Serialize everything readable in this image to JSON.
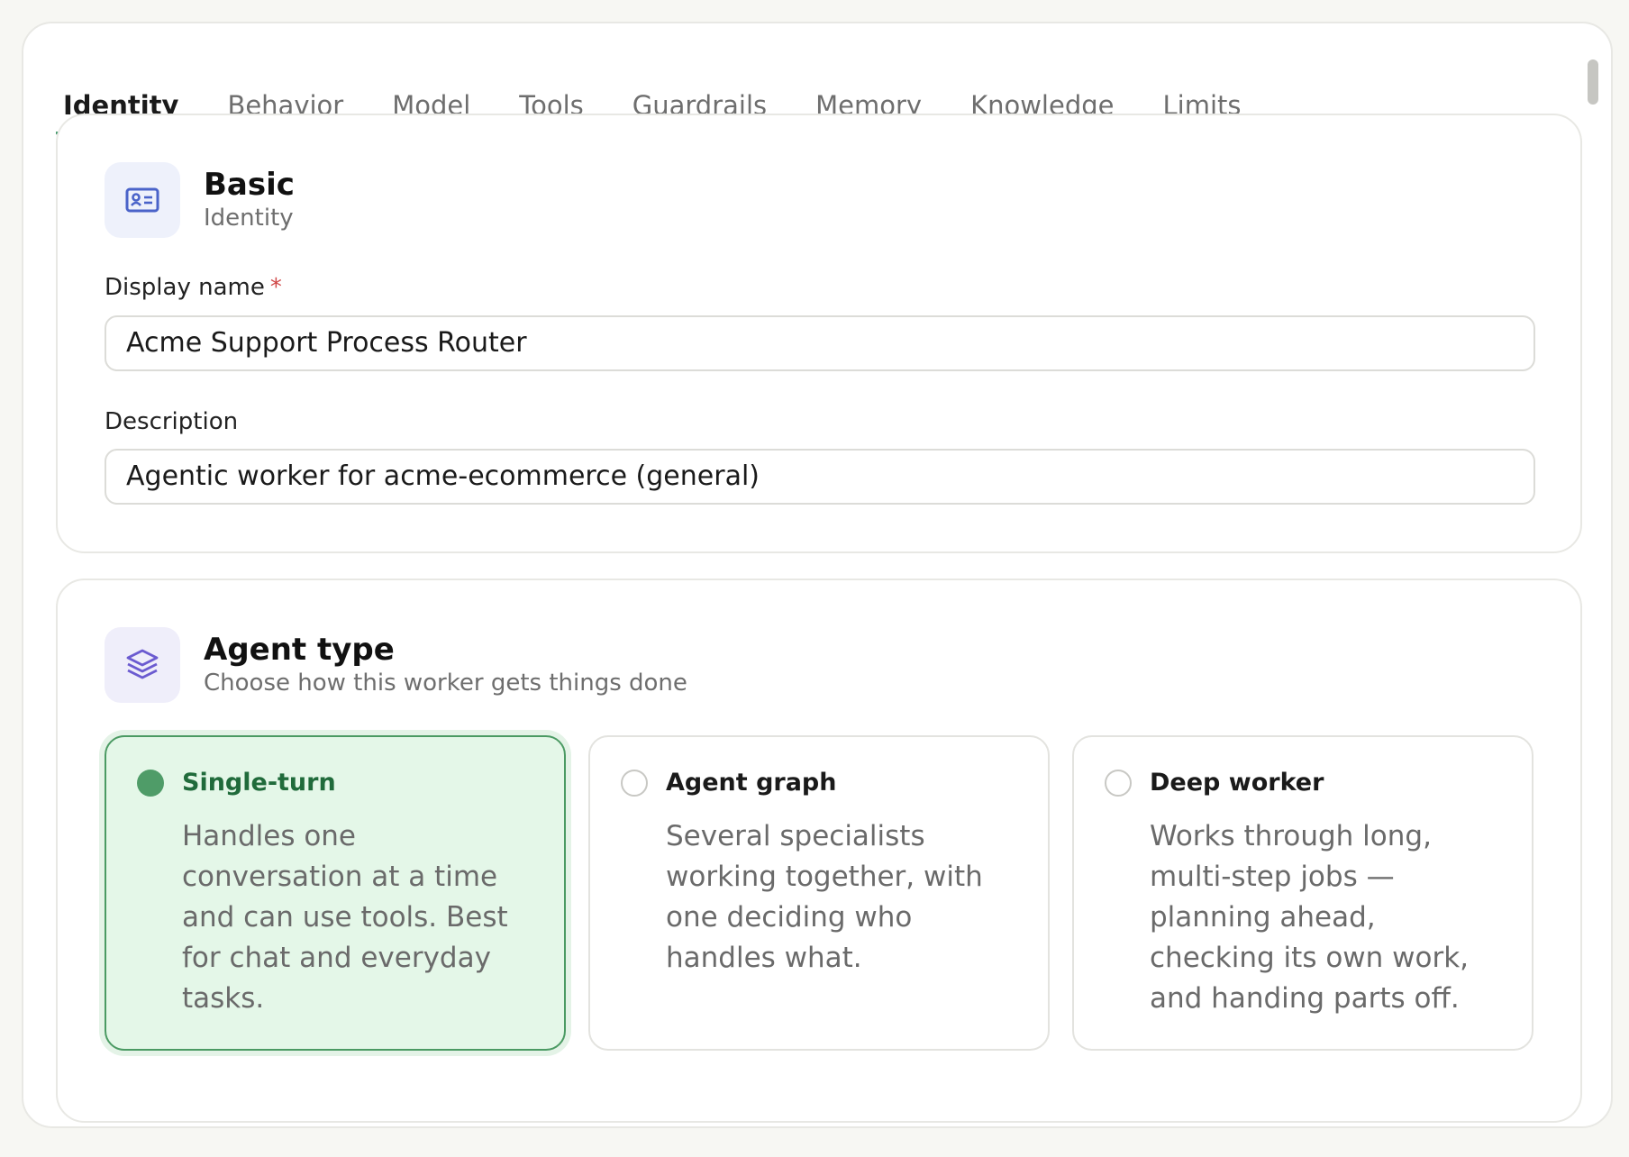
{
  "tabs": [
    "Identity",
    "Behavior",
    "Model",
    "Tools",
    "Guardrails",
    "Memory",
    "Knowledge",
    "Limits"
  ],
  "active_tab": "Identity",
  "basic": {
    "title": "Basic",
    "subtitle": "Identity",
    "icon": "id-card-icon",
    "display_name_label": "Display name",
    "required_mark": "*",
    "display_name_value": "Acme Support Process Router",
    "description_label": "Description",
    "description_value": "Agentic worker for acme-ecommerce (general)"
  },
  "agent_type": {
    "title": "Agent type",
    "subtitle": "Choose how this worker gets things done",
    "icon": "layers-icon",
    "options": [
      {
        "title": "Single-turn",
        "description": "Handles one conversation at a time and can use tools. Best for chat and everyday tasks.",
        "selected": true
      },
      {
        "title": "Agent graph",
        "description": "Several specialists working together, with one deciding who handles what.",
        "selected": false
      },
      {
        "title": "Deep worker",
        "description": "Works through long, multi-step jobs — planning ahead, checking its own work, and handing parts off.",
        "selected": false
      }
    ]
  },
  "colors": {
    "accent_green": "#4a9b6f",
    "selected_bg": "#e4f7e8",
    "required_red": "#d04848",
    "icon_blue": "#4a63c9",
    "icon_violet": "#6b5bd0"
  }
}
